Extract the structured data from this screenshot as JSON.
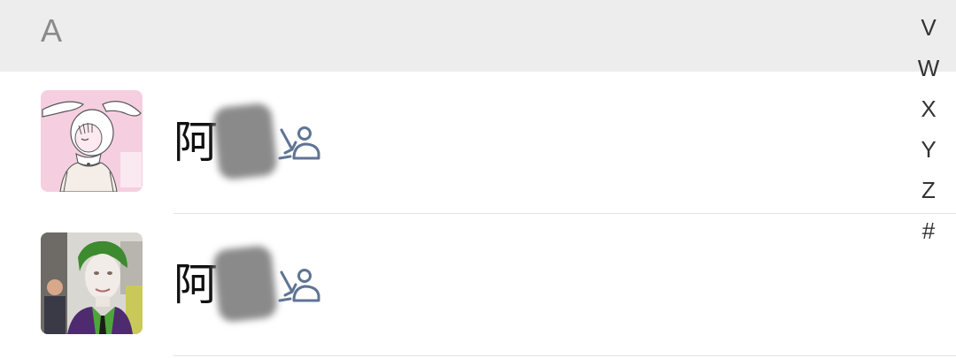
{
  "section": {
    "letter": "A"
  },
  "contacts": [
    {
      "name": "阿",
      "avatar": "avatar-illustrated-girl",
      "tag_icon": "contact-tag-icon"
    },
    {
      "name": "阿",
      "avatar": "avatar-photo-joker",
      "tag_icon": "contact-tag-icon"
    }
  ],
  "index_bar": {
    "letters": [
      "V",
      "W",
      "X",
      "Y",
      "Z",
      "#"
    ]
  },
  "colors": {
    "section_header_bg": "#ededed",
    "tag_icon": "#5f7494",
    "avatar_pink": "#f5cfe0",
    "avatar_green": "#4fa53a"
  }
}
